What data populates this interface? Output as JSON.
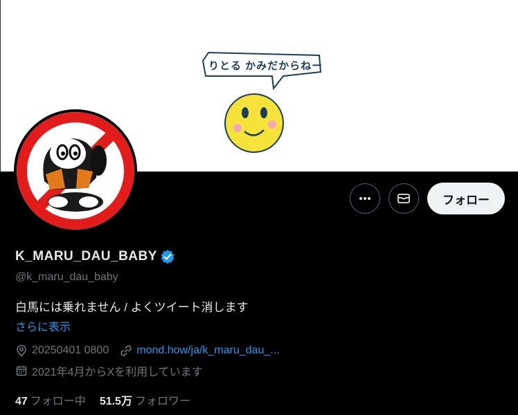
{
  "banner": {
    "bubble_text": "りとる かみだからねー"
  },
  "actions": {
    "more_icon": "more-horizontal-icon",
    "message_icon": "envelope-icon",
    "follow_label": "フォロー"
  },
  "profile": {
    "display_name": "K_MARU_DAU_BABY",
    "verified_icon": "verified-badge-icon",
    "handle": "@k_maru_dau_baby",
    "bio": "白馬には乗れません / よくツイート消します",
    "show_more": "さらに表示",
    "location": "20250401 0800",
    "link": "mond.how/ja/k_maru_dau_...",
    "joined": "2021年4月からXを利用しています"
  },
  "stats": {
    "following_count": "47",
    "following_label": "フォロー中",
    "followers_count": "51.5万",
    "followers_label": "フォロワー"
  },
  "colors": {
    "accent": "#1d9bf0",
    "background": "#000000",
    "muted": "#71767b"
  }
}
